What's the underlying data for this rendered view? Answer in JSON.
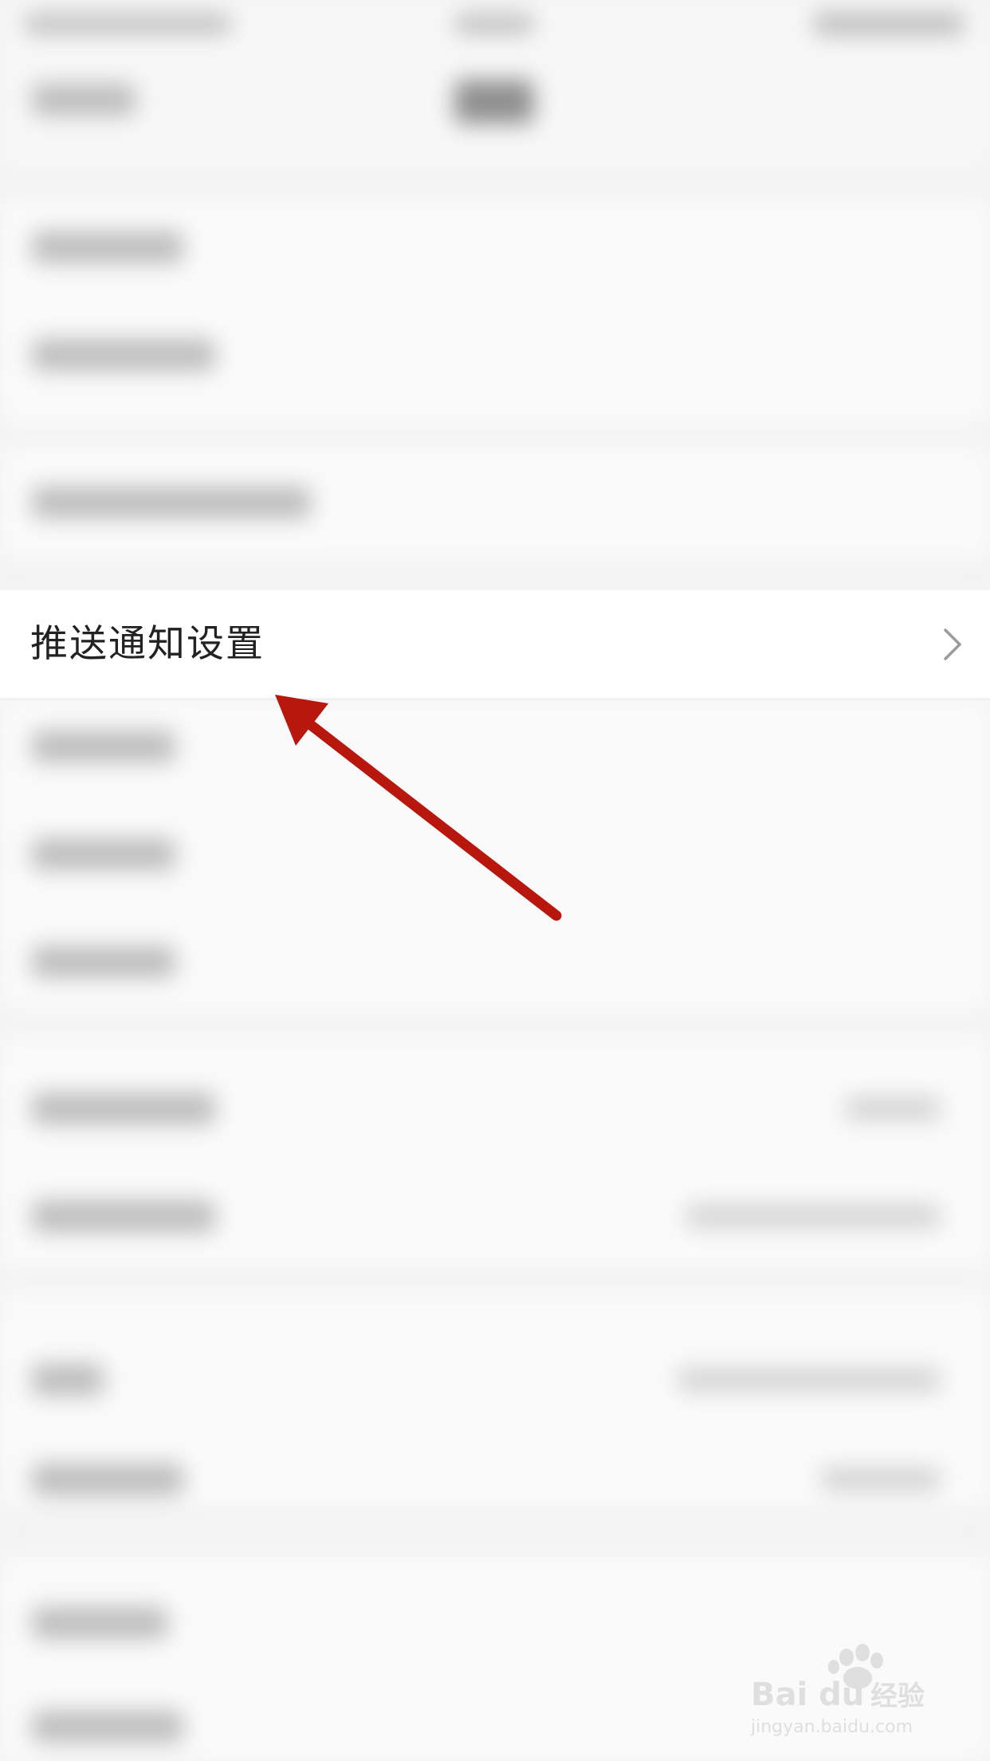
{
  "focused_row": {
    "label": "推送通知设置",
    "trailing_icon": "chevron-right-icon"
  },
  "annotation": {
    "type": "arrow",
    "color": "#b8170e"
  },
  "watermark": {
    "brand_text": "Bai du 经验",
    "url_text": "jingyan.baidu.com"
  },
  "colors": {
    "background": "#f3f3f3",
    "row_background": "#ffffff",
    "label_text": "#222222",
    "arrow": "#b8170e"
  }
}
